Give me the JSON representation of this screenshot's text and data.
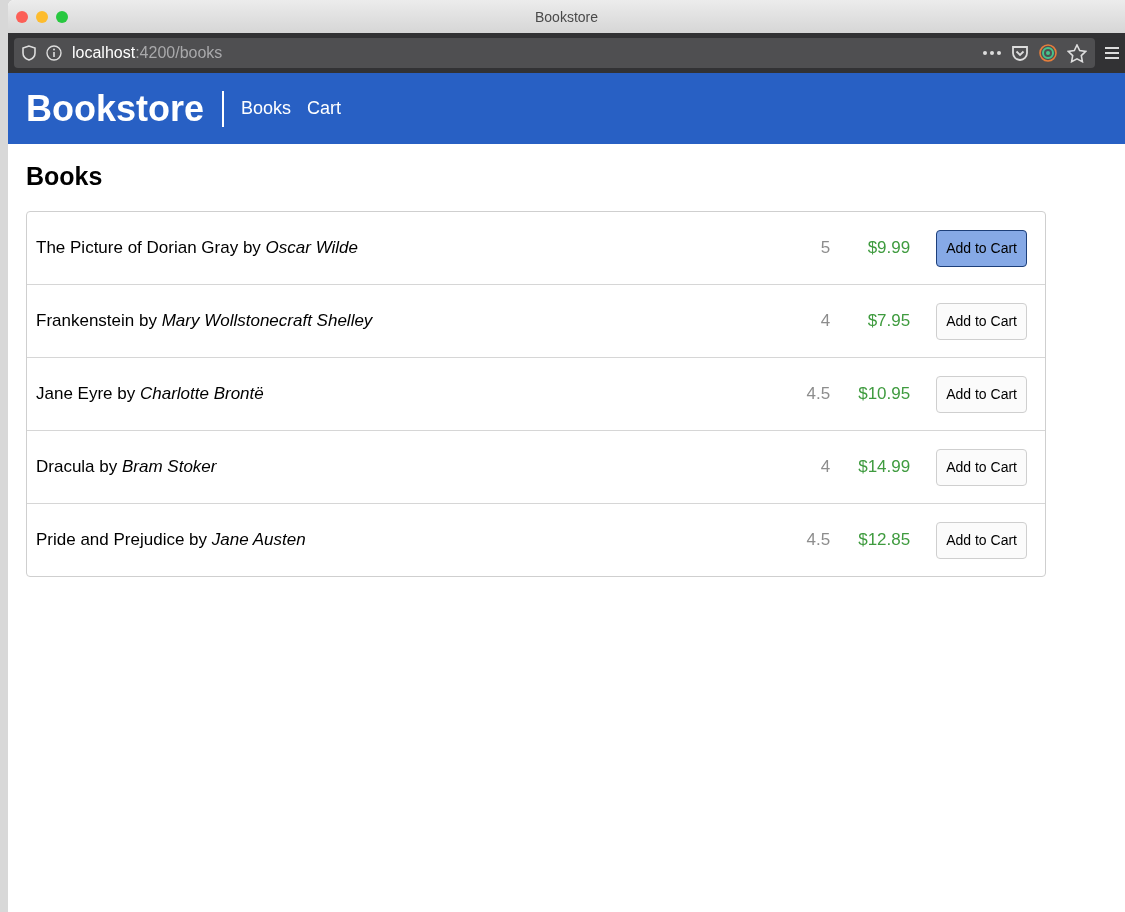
{
  "window": {
    "title": "Bookstore"
  },
  "address_bar": {
    "host": "localhost",
    "path": ":4200/books"
  },
  "navbar": {
    "brand": "Bookstore",
    "links": [
      {
        "label": "Books"
      },
      {
        "label": "Cart"
      }
    ]
  },
  "page": {
    "heading": "Books"
  },
  "books": [
    {
      "text": "The Picture of Dorian Gray by *Oscar Wilde*",
      "rating": "5",
      "price": "$9.99",
      "button": "Add to Cart",
      "focused": true
    },
    {
      "text": "Frankenstein by *Mary Wollstonecraft Shelley*",
      "rating": "4",
      "price": "$7.95",
      "button": "Add to Cart",
      "focused": false
    },
    {
      "text": "Jane Eyre by *Charlotte Brontë*",
      "rating": "4.5",
      "price": "$10.95",
      "button": "Add to Cart",
      "focused": false
    },
    {
      "text": "Dracula by *Bram Stoker*",
      "rating": "4",
      "price": "$14.99",
      "button": "Add to Cart",
      "focused": false
    },
    {
      "text": "Pride and Prejudice by *Jane Austen*",
      "rating": "4.5",
      "price": "$12.85",
      "button": "Add to Cart",
      "focused": false
    }
  ]
}
